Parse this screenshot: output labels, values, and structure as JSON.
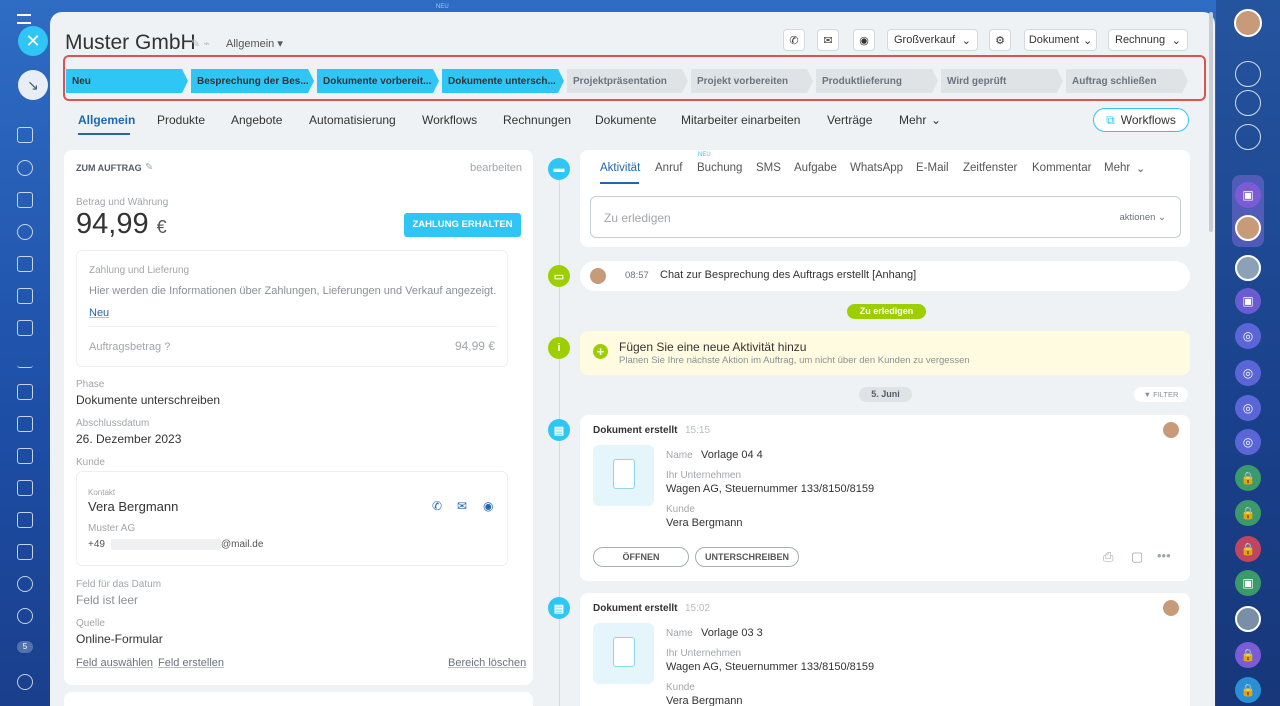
{
  "header": {
    "title": "Muster GmbH",
    "category": "Allgemein",
    "sale_type": "Großverkauf",
    "document": "Dokument",
    "invoice": "Rechnung",
    "neu_top": "NEU"
  },
  "stages": [
    {
      "label": "Neu",
      "active": true
    },
    {
      "label": "Besprechung der Bes...",
      "active": true
    },
    {
      "label": "Dokumente vorbereit...",
      "active": true
    },
    {
      "label": "Dokumente untersch...",
      "active": true
    },
    {
      "label": "Projektpräsentation",
      "active": false
    },
    {
      "label": "Projekt vorbereiten",
      "active": false
    },
    {
      "label": "Produktlieferung",
      "active": false
    },
    {
      "label": "Wird geprüft",
      "active": false
    },
    {
      "label": "Auftrag schließen",
      "active": false
    }
  ],
  "tabs": [
    "Allgemein",
    "Produkte",
    "Angebote",
    "Automatisierung",
    "Workflows",
    "Rechnungen",
    "Dokumente",
    "Mitarbeiter einarbeiten",
    "Verträge",
    "Mehr"
  ],
  "workflows_button": "Workflows",
  "left_card": {
    "section": "ZUM AUFTRAG",
    "edit": "bearbeiten",
    "amount_label": "Betrag und Währung",
    "amount": "94,99",
    "currency": "€",
    "pay_button": "ZAHLUNG ERHALTEN",
    "payment_title": "Zahlung und Lieferung",
    "payment_text": "Hier werden die Informationen über Zahlungen, Lieferungen und Verkauf angezeigt.",
    "payment_new": "Neu",
    "order_amount_label": "Auftragsbetrag",
    "order_amount": "94,99 €",
    "phase_label": "Phase",
    "phase": "Dokumente unterschreiben",
    "close_label": "Abschlussdatum",
    "close_date": "26. Dezember 2023",
    "client_label": "Kunde",
    "contact_label": "Kontakt",
    "contact": "Vera Bergmann",
    "company": "Muster AG",
    "phone": "+49",
    "email": "@mail.de",
    "date_field_label": "Feld für das Datum",
    "date_field": "Feld ist leer",
    "source_label": "Quelle",
    "source": "Online-Formular",
    "select_field": "Feld auswählen",
    "create_field": "Feld erstellen",
    "delete_section": "Bereich löschen"
  },
  "editor": {
    "tabs": [
      "Aktivität",
      "Anruf",
      "Buchung",
      "SMS",
      "Aufgabe",
      "WhatsApp",
      "E-Mail",
      "Zeitfenster",
      "Kommentar",
      "Mehr"
    ],
    "buchung_badge": "NEU",
    "placeholder": "Zu erledigen",
    "actions": "aktionen"
  },
  "chat": {
    "time": "08:57",
    "text": "Chat zur Besprechung des Auftrags erstellt [Anhang]"
  },
  "todo_badge": "Zu erledigen",
  "hint": {
    "title": "Fügen Sie eine neue Aktivität hinzu",
    "text": "Planen Sie Ihre nächste Aktion im Auftrag, um nicht über den Kunden zu vergessen"
  },
  "date_badge": "5. Juni",
  "filter": "FILTER",
  "docs": [
    {
      "title": "Dokument erstellt",
      "time": "15:15",
      "name_label": "Name",
      "name": "Vorlage 04 4",
      "company_label": "Ihr Unternehmen",
      "company": "Wagen AG, Steuernummer 133/8150/8159",
      "client_label": "Kunde",
      "client": "Vera Bergmann",
      "open": "ÖFFNEN",
      "sign": "UNTERSCHREIBEN"
    },
    {
      "title": "Dokument erstellt",
      "time": "15:02",
      "name_label": "Name",
      "name": "Vorlage 03 3",
      "company_label": "Ihr Unternehmen",
      "company": "Wagen AG, Steuernummer 133/8150/8159",
      "client_label": "Kunde",
      "client": "Vera Bergmann"
    }
  ],
  "sidebar_badge": "5"
}
